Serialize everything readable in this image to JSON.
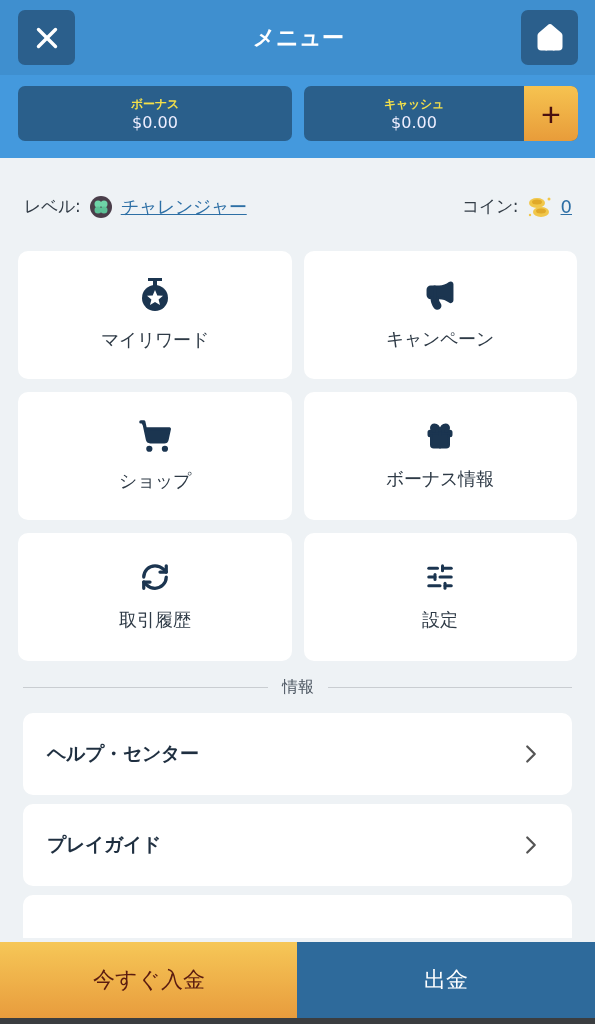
{
  "header": {
    "title": "メニュー"
  },
  "balances": [
    {
      "label": "ボーナス",
      "amount": "$0.00",
      "kind": "plain"
    },
    {
      "label": "キャッシュ",
      "amount": "$0.00",
      "kind": "add",
      "add_label": "+"
    }
  ],
  "level": {
    "label": "レベル:",
    "value": "チャレンジャー"
  },
  "coins": {
    "label": "コイン:",
    "value": "0"
  },
  "tiles": [
    {
      "label": "マイリワード"
    },
    {
      "label": "キャンペーン"
    },
    {
      "label": "ショップ"
    },
    {
      "label": "ボーナス情報"
    },
    {
      "label": "取引履歴"
    },
    {
      "label": "設定"
    }
  ],
  "info": {
    "heading": "情報",
    "items": [
      {
        "label": "ヘルプ・センター"
      },
      {
        "label": "プレイガイド"
      }
    ]
  },
  "footer": [
    {
      "label": "今すぐ入金",
      "kind": "primary"
    },
    {
      "label": "出金",
      "kind": "secondary"
    }
  ]
}
